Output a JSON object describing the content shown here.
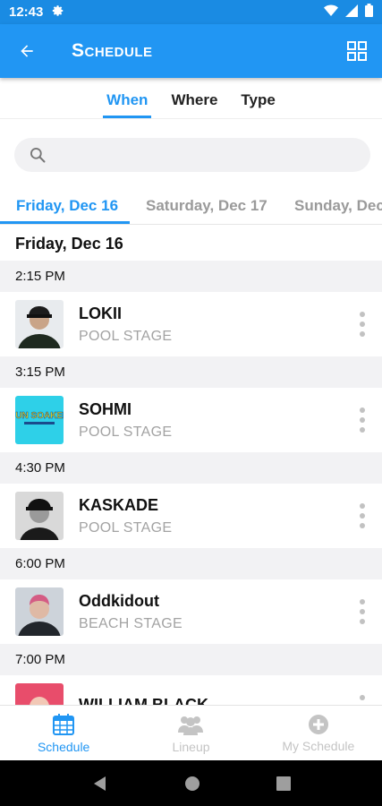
{
  "status_bar": {
    "time": "12:43"
  },
  "app_bar": {
    "title": "Schedule"
  },
  "top_tabs": [
    {
      "label": "When",
      "active": true
    },
    {
      "label": "Where",
      "active": false
    },
    {
      "label": "Type",
      "active": false
    }
  ],
  "search": {
    "placeholder": ""
  },
  "day_tabs": [
    {
      "label": "Friday, Dec 16",
      "active": true
    },
    {
      "label": "Saturday, Dec 17",
      "active": false
    },
    {
      "label": "Sunday, Dec",
      "active": false
    }
  ],
  "section_title": "Friday, Dec 16",
  "schedule": [
    {
      "time": "2:15 PM",
      "artist": "LOKII",
      "stage": "POOL STAGE",
      "thumb": "lokii-photo"
    },
    {
      "time": "3:15 PM",
      "artist": "SOHMI",
      "stage": "POOL STAGE",
      "thumb": "sunsoaked-logo",
      "thumb_text": "SUN SOAKED"
    },
    {
      "time": "4:30 PM",
      "artist": "KASKADE",
      "stage": "POOL STAGE",
      "thumb": "kaskade-photo"
    },
    {
      "time": "6:00 PM",
      "artist": "Oddkidout",
      "stage": "BEACH STAGE",
      "thumb": "oddkidout-photo"
    },
    {
      "time": "7:00 PM",
      "artist": "WILLIAM BLACK",
      "stage": "",
      "thumb": "williamblack-photo"
    }
  ],
  "bottom_nav": [
    {
      "label": "Schedule",
      "icon": "calendar-icon",
      "active": true
    },
    {
      "label": "Lineup",
      "icon": "people-icon",
      "active": false
    },
    {
      "label": "My Schedule",
      "icon": "plus-circle-icon",
      "active": false
    }
  ],
  "colors": {
    "primary": "#2196f3",
    "status_bar": "#1a8be3",
    "muted": "#a3a3a3"
  }
}
